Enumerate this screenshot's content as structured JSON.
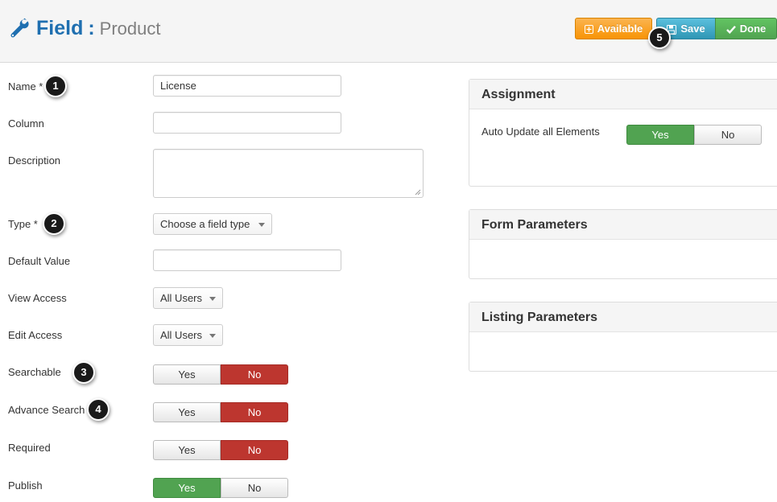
{
  "header": {
    "title_strong": "Field",
    "title_sep": ":",
    "title_sub": "Product",
    "buttons": {
      "available": "Available",
      "save": "Save",
      "done": "Done"
    }
  },
  "colors": {
    "brand_blue": "#1f6fb0",
    "available": "#f89406",
    "save": "#2f96b4",
    "done": "#51a351",
    "toggle_no_active": "#bd362f",
    "toggle_yes_active": "#51a351"
  },
  "icons": {
    "title": "wrench-icon",
    "available": "plus-square-icon",
    "save": "floppy-disk-icon",
    "done": "checkmark-icon"
  },
  "badges": [
    "1",
    "2",
    "3",
    "4",
    "5"
  ],
  "form": {
    "name": {
      "label": "Name *",
      "value": "License"
    },
    "column": {
      "label": "Column",
      "value": ""
    },
    "description": {
      "label": "Description",
      "value": ""
    },
    "type": {
      "label": "Type *",
      "selected": "Choose a field type"
    },
    "default_value": {
      "label": "Default Value",
      "value": ""
    },
    "view_access": {
      "label": "View Access",
      "selected": "All Users"
    },
    "edit_access": {
      "label": "Edit Access",
      "selected": "All Users"
    },
    "searchable": {
      "label": "Searchable",
      "yes": "Yes",
      "no": "No",
      "active": "No"
    },
    "advance_search": {
      "label": "Advance Search",
      "yes": "Yes",
      "no": "No",
      "active": "No"
    },
    "required": {
      "label": "Required",
      "yes": "Yes",
      "no": "No",
      "active": "No"
    },
    "publish": {
      "label": "Publish",
      "yes": "Yes",
      "no": "No",
      "active": "Yes"
    }
  },
  "panels": {
    "assignment": {
      "title": "Assignment",
      "auto_update_label": "Auto Update all Elements",
      "yes": "Yes",
      "no": "No",
      "active": "Yes"
    },
    "form_parameters": {
      "title": "Form Parameters"
    },
    "listing_parameters": {
      "title": "Listing Parameters"
    }
  }
}
